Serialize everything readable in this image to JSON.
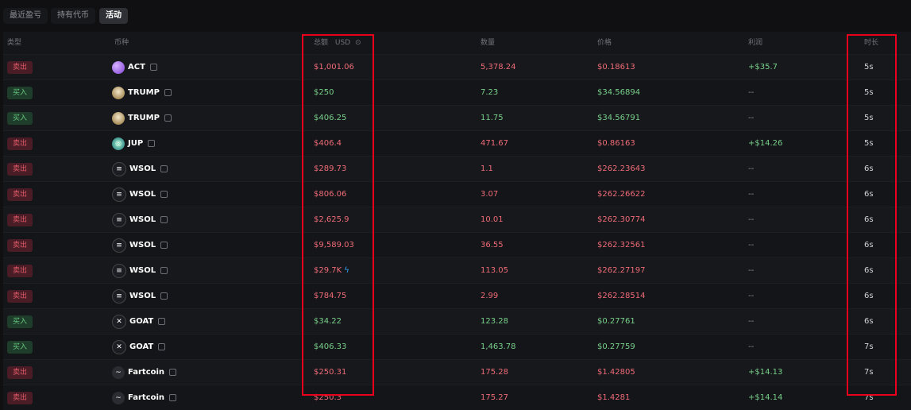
{
  "tabs": [
    {
      "label": "最近盈亏",
      "active": false
    },
    {
      "label": "持有代币",
      "active": false
    },
    {
      "label": "活动",
      "active": true
    }
  ],
  "headers": {
    "type": "类型",
    "coin": "币种",
    "total": "总额",
    "total_unit": "USD",
    "qty": "数量",
    "price": "价格",
    "profit": "利润",
    "age": "时长"
  },
  "rows": [
    {
      "type": "卖出",
      "side": "sell",
      "coin": "ACT",
      "icon": "act-icon",
      "total": "$1,001.06",
      "qty": "5,378.24",
      "price": "$0.18613",
      "profit": "+$35.7",
      "age": "5s"
    },
    {
      "type": "买入",
      "side": "buy",
      "coin": "TRUMP",
      "icon": "trump-icon",
      "total": "$250",
      "qty": "7.23",
      "price": "$34.56894",
      "profit": "--",
      "age": "5s"
    },
    {
      "type": "买入",
      "side": "buy",
      "coin": "TRUMP",
      "icon": "trump-icon",
      "total": "$406.25",
      "qty": "11.75",
      "price": "$34.56791",
      "profit": "--",
      "age": "5s"
    },
    {
      "type": "卖出",
      "side": "sell",
      "coin": "JUP",
      "icon": "jup-icon",
      "total": "$406.4",
      "qty": "471.67",
      "price": "$0.86163",
      "profit": "+$14.26",
      "age": "5s"
    },
    {
      "type": "卖出",
      "side": "sell",
      "coin": "WSOL",
      "icon": "wsol-icon",
      "total": "$289.73",
      "qty": "1.1",
      "price": "$262.23643",
      "profit": "--",
      "age": "6s"
    },
    {
      "type": "卖出",
      "side": "sell",
      "coin": "WSOL",
      "icon": "wsol-icon",
      "total": "$806.06",
      "qty": "3.07",
      "price": "$262.26622",
      "profit": "--",
      "age": "6s"
    },
    {
      "type": "卖出",
      "side": "sell",
      "coin": "WSOL",
      "icon": "wsol-icon",
      "total": "$2,625.9",
      "qty": "10.01",
      "price": "$262.30774",
      "profit": "--",
      "age": "6s"
    },
    {
      "type": "卖出",
      "side": "sell",
      "coin": "WSOL",
      "icon": "wsol-icon",
      "total": "$9,589.03",
      "qty": "36.55",
      "price": "$262.32561",
      "profit": "--",
      "age": "6s"
    },
    {
      "type": "卖出",
      "side": "sell",
      "coin": "WSOL",
      "icon": "wsol-icon",
      "total": "$29.7K",
      "qty": "113.05",
      "price": "$262.27197",
      "profit": "--",
      "age": "6s",
      "bolt": true
    },
    {
      "type": "卖出",
      "side": "sell",
      "coin": "WSOL",
      "icon": "wsol-icon",
      "total": "$784.75",
      "qty": "2.99",
      "price": "$262.28514",
      "profit": "--",
      "age": "6s"
    },
    {
      "type": "买入",
      "side": "buy",
      "coin": "GOAT",
      "icon": "goat-icon",
      "total": "$34.22",
      "qty": "123.28",
      "price": "$0.27761",
      "profit": "--",
      "age": "6s"
    },
    {
      "type": "买入",
      "side": "buy",
      "coin": "GOAT",
      "icon": "goat-icon",
      "total": "$406.33",
      "qty": "1,463.78",
      "price": "$0.27759",
      "profit": "--",
      "age": "7s"
    },
    {
      "type": "卖出",
      "side": "sell",
      "coin": "Fartcoin",
      "icon": "fartcoin-icon",
      "total": "$250.31",
      "qty": "175.28",
      "price": "$1.42805",
      "profit": "+$14.13",
      "age": "7s"
    },
    {
      "type": "卖出",
      "side": "sell",
      "coin": "Fartcoin",
      "icon": "fartcoin-icon",
      "total": "$250.3",
      "qty": "175.27",
      "price": "$1.4281",
      "profit": "+$14.14",
      "age": "7s"
    }
  ],
  "colors": {
    "sell": "#ef6b78",
    "buy": "#78d08b",
    "highlight": "#e8001c"
  }
}
